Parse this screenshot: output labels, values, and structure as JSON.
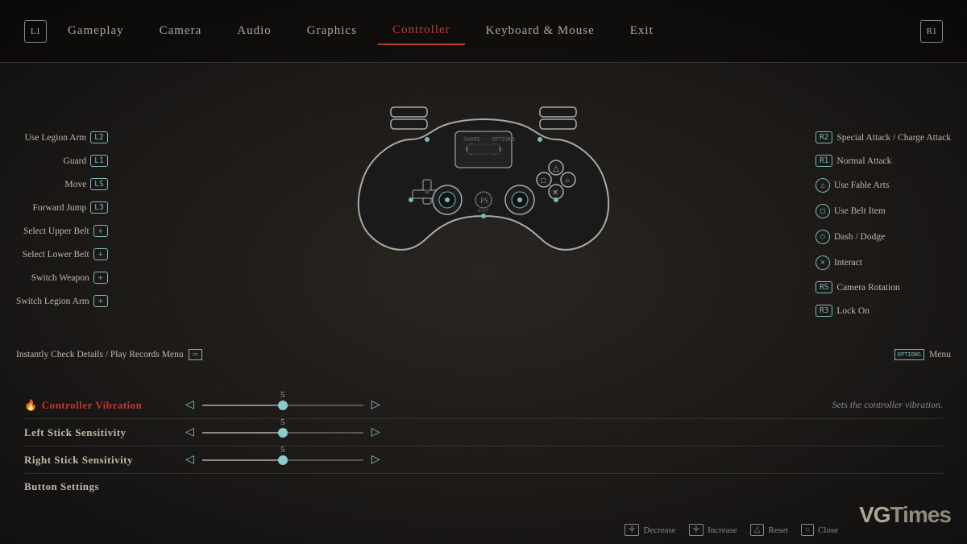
{
  "nav": {
    "left_btn": "L1",
    "right_btn": "R1",
    "items": [
      {
        "label": "Gameplay",
        "active": false
      },
      {
        "label": "Camera",
        "active": false
      },
      {
        "label": "Audio",
        "active": false
      },
      {
        "label": "Graphics",
        "active": false
      },
      {
        "label": "Controller",
        "active": true
      },
      {
        "label": "Keyboard & Mouse",
        "active": false
      },
      {
        "label": "Exit",
        "active": false
      }
    ]
  },
  "left_labels": [
    {
      "text": "Use Legion Arm",
      "tag": "L2"
    },
    {
      "text": "Guard",
      "tag": "L1"
    },
    {
      "text": "Move",
      "tag": "LS"
    },
    {
      "text": "Forward Jump",
      "tag": "L3"
    },
    {
      "text": "Select Upper Belt",
      "tag": "✛"
    },
    {
      "text": "Select Lower Belt",
      "tag": "✛"
    },
    {
      "text": "Switch Weapon",
      "tag": "✛"
    },
    {
      "text": "Switch Legion Arm",
      "tag": "✛"
    }
  ],
  "right_labels": [
    {
      "text": "Special Attack / Charge Attack",
      "tag": "R2"
    },
    {
      "text": "Normal Attack",
      "tag": "R1"
    },
    {
      "text": "Use Fable Arts",
      "sym": "△"
    },
    {
      "text": "Use Belt Item",
      "sym": "□"
    },
    {
      "text": "Dash / Dodge",
      "sym": "○"
    },
    {
      "text": "Interact",
      "sym": "✕"
    },
    {
      "text": "Camera Rotation",
      "tag": "RS"
    },
    {
      "text": "Lock On",
      "tag": "R3"
    }
  ],
  "bottom_labels": {
    "left": "Instantly Check Details / Play Records Menu",
    "left_tag": "▭",
    "right": "Menu",
    "right_tag": "OPTIONS"
  },
  "settings": [
    {
      "label": "Controller Vibration",
      "active": true,
      "value": 5,
      "desc": "Sets the controller vibration."
    },
    {
      "label": "Left Stick Sensitivity",
      "active": false,
      "value": 5,
      "desc": ""
    },
    {
      "label": "Right Stick Sensitivity",
      "active": false,
      "value": 5,
      "desc": ""
    },
    {
      "label": "Button Settings",
      "active": false,
      "value": null,
      "desc": ""
    }
  ],
  "bottom_actions": [
    {
      "icon": "✛",
      "label": "Decrease"
    },
    {
      "icon": "✛",
      "label": "Increase"
    },
    {
      "icon": "△",
      "label": "Reset"
    },
    {
      "icon": "○",
      "label": "Close"
    }
  ],
  "watermark": "VGTimes"
}
